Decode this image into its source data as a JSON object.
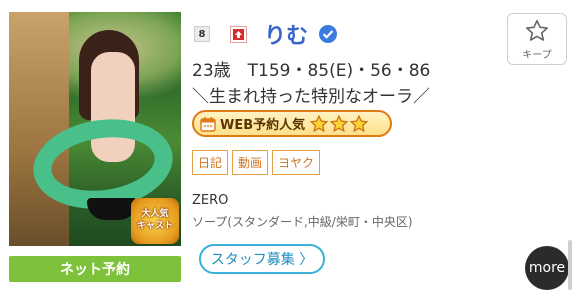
{
  "profile": {
    "rank": "8",
    "name": "りむ",
    "stats": "23歳　T159・85(E)・56・86",
    "catchphrase": "＼生まれ持った特別なオーラ／",
    "web_label": "WEB予約人気",
    "web_stars": 3,
    "tags": [
      "日記",
      "動画",
      "ヨヤク"
    ],
    "shop": "ZERO",
    "area": "ソープ(スタンダード,中級/栄町・中央区)"
  },
  "photo": {
    "badge_text_line1": "大人気",
    "badge_text_line2": "キャスト"
  },
  "buttons": {
    "keep_label": "キープ",
    "net_reserve_label": "ネット予約",
    "staff_label": "スタッフ募集 〉",
    "more_label": "more"
  },
  "colors": {
    "name": "#3b66c9",
    "net_button": "#7dc23a",
    "tag_border": "#e6a04a",
    "web_badge_border": "#e07b14",
    "staff_border": "#3bb1d8"
  }
}
